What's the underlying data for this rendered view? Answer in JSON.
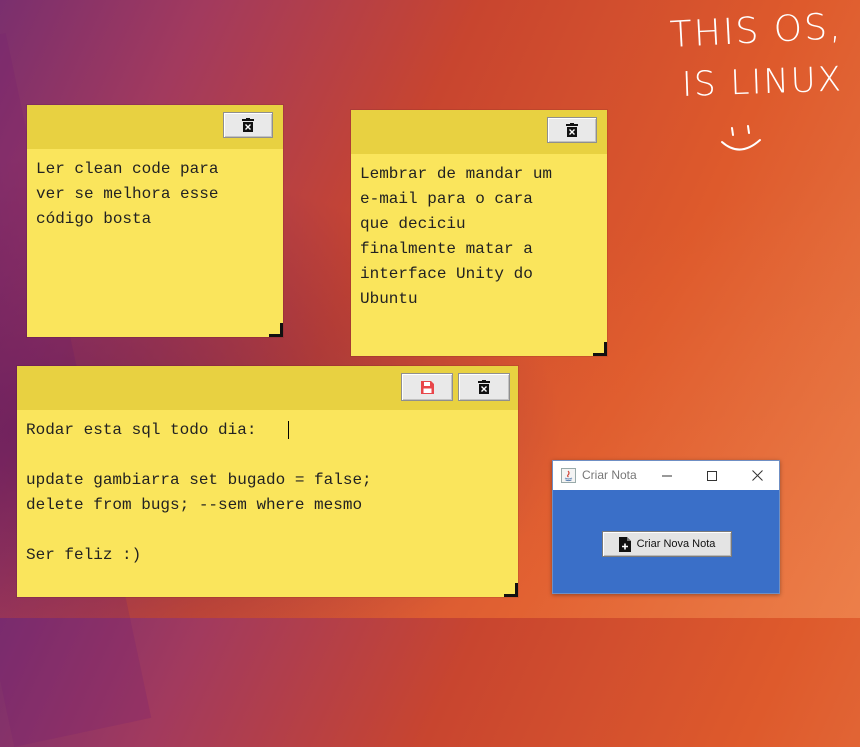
{
  "handwriting": {
    "line1": "THIS OS,",
    "line2": "IS LINUX",
    "smile": ":)"
  },
  "notes": [
    {
      "text": "Ler clean code para\nver se melhora esse\ncódigo bosta",
      "buttons": [
        "trash-icon"
      ]
    },
    {
      "text": "Lembrar de mandar um\ne-mail para o cara\nque deciciu\nfinalmente matar a\ninterface Unity do\nUbuntu",
      "buttons": [
        "trash-icon"
      ]
    },
    {
      "text": "Rodar esta sql todo dia:\n\nupdate gambiarra set bugado = false;\ndelete from bugs; --sem where mesmo\n\nSer feliz :)",
      "buttons": [
        "save-icon",
        "trash-icon"
      ]
    }
  ],
  "window": {
    "title": "Criar Nota",
    "button_label": "Criar Nova Nota",
    "accent": "#3a6fc8"
  }
}
